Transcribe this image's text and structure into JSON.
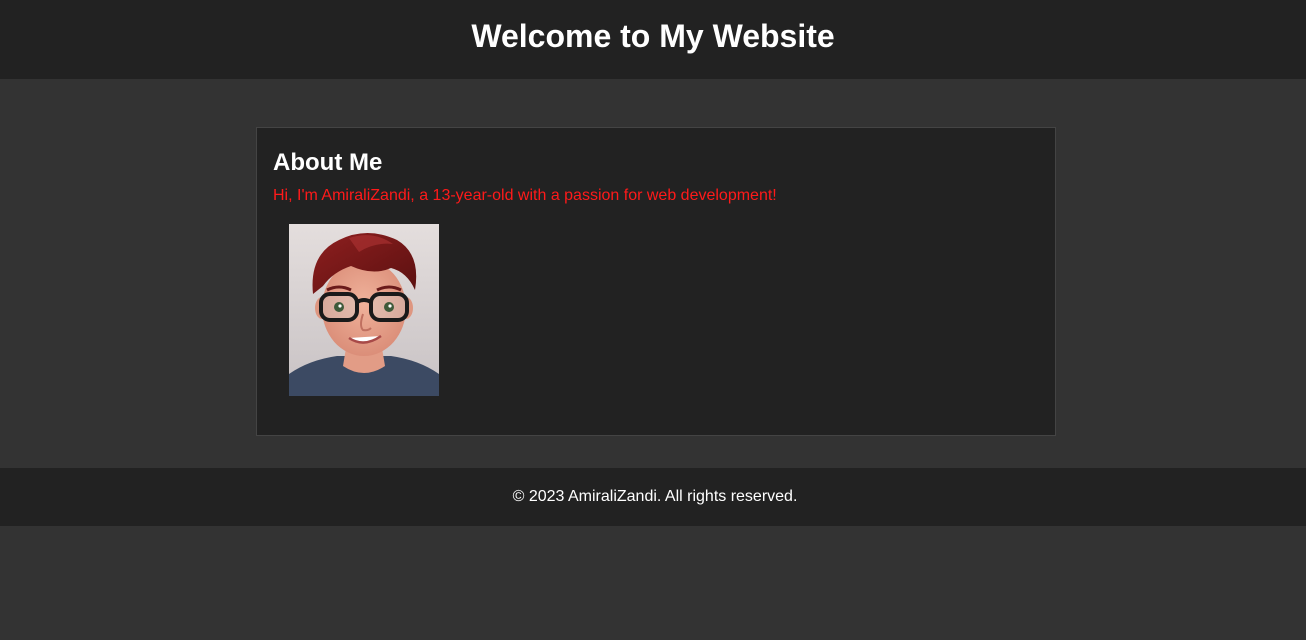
{
  "header": {
    "title": "Welcome to My Website"
  },
  "about": {
    "heading": "About Me",
    "intro": "Hi, I'm AmiraliZandi, a 13-year-old with a passion for web development!",
    "image_alt": "avatar-portrait"
  },
  "footer": {
    "copyright": "© 2023 AmiraliZandi. All rights reserved."
  },
  "colors": {
    "page_bg": "#333333",
    "panel_bg": "#222222",
    "accent_text": "#ff1a1a",
    "text": "#ffffff"
  }
}
